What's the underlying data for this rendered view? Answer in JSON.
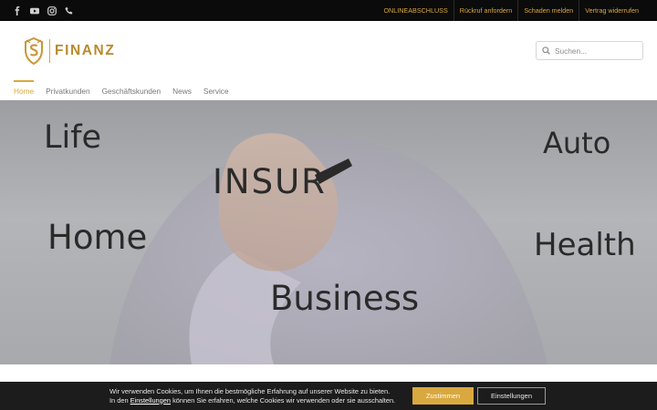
{
  "topbar": {
    "social_icons": [
      "facebook-icon",
      "youtube-icon",
      "instagram-icon",
      "phone-icon"
    ],
    "links": [
      "ONLINEABSCHLUSS",
      "Rückruf anfordern",
      "Schaden melden",
      "Vertrag widerrufen"
    ]
  },
  "header": {
    "logo_text": "FINANZ",
    "search_placeholder": "Suchen...",
    "nav": [
      "Home",
      "Privatkunden",
      "Geschäftskunden",
      "News",
      "Service"
    ],
    "active_nav": "Home"
  },
  "hero": {
    "words": [
      "Life",
      "Auto",
      "INSUR",
      "Home",
      "Health",
      "Business"
    ]
  },
  "cookie": {
    "line1": "Wir verwenden Cookies, um Ihnen die bestmögliche Erfahrung auf unserer Website zu bieten.",
    "line2_pre": "In den",
    "line2_link": "Einstellungen",
    "line2_post": "können Sie erfahren, welche Cookies wir verwenden oder sie ausschalten.",
    "accept_label": "Zustimmen",
    "settings_label": "Einstellungen"
  },
  "colors": {
    "accent": "#d9a83f",
    "topbar": "#0b0b0b",
    "cookie_bg": "#1c1c1c"
  }
}
